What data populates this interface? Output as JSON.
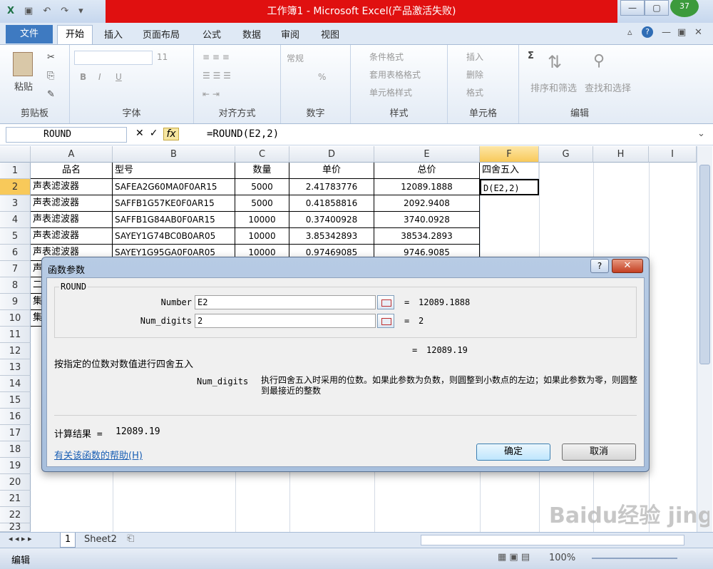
{
  "window": {
    "title": "工作簿1 - Microsoft Excel(产品激活失败)",
    "badge": "37"
  },
  "tabs": {
    "file": "文件",
    "home": "开始",
    "others": [
      "插入",
      "页面布局",
      "公式",
      "数据",
      "审阅",
      "视图"
    ]
  },
  "ribbon": {
    "clipboard": {
      "label": "剪贴板",
      "paste": "粘贴"
    },
    "font": {
      "label": "字体",
      "size": "11",
      "bold": "B",
      "italic": "I",
      "underline": "U"
    },
    "alignment": {
      "label": "对齐方式"
    },
    "number": {
      "label": "数字",
      "format": "常规",
      "percent": "%"
    },
    "styles": {
      "label": "样式",
      "items": [
        "条件格式",
        "套用表格格式",
        "单元格样式"
      ]
    },
    "cells": {
      "label": "单元格",
      "items": [
        "插入",
        "删除",
        "格式"
      ]
    },
    "editing": {
      "label": "编辑",
      "sort": "排序和筛选",
      "find": "查找和选择",
      "sum": "Σ"
    }
  },
  "formula_bar": {
    "name_box": "ROUND",
    "fx": "fx",
    "formula": "=ROUND(E2,2)"
  },
  "columns": [
    "A",
    "B",
    "C",
    "D",
    "E",
    "F",
    "G",
    "H",
    "I"
  ],
  "rows": [
    "1",
    "2",
    "3",
    "4",
    "5",
    "6",
    "7",
    "8",
    "9",
    "10",
    "11",
    "12",
    "13",
    "14",
    "15",
    "16",
    "17",
    "18",
    "19",
    "20",
    "21",
    "22",
    "23"
  ],
  "header_row": [
    "品名",
    "型号",
    "数量",
    "单价",
    "总价",
    "四舍五入"
  ],
  "data_rows": [
    [
      "声表滤波器",
      "SAFEA2G60MA0F0AR15",
      "5000",
      "2.41783776",
      "12089.1888",
      "D(E2,2)"
    ],
    [
      "声表滤波器",
      "SAFFB1G57KE0F0AR15",
      "5000",
      "0.41858816",
      "2092.9408",
      ""
    ],
    [
      "声表滤波器",
      "SAFFB1G84AB0F0AR15",
      "10000",
      "0.37400928",
      "3740.0928",
      ""
    ],
    [
      "声表滤波器",
      "SAYEY1G74BC0B0AR05",
      "10000",
      "3.85342893",
      "38534.2893",
      ""
    ],
    [
      "声表滤波器",
      "SAYEY1G95GA0F0AR05",
      "10000",
      "0.97469085",
      "9746.9085",
      ""
    ]
  ],
  "partial_rows": [
    "声",
    "二",
    "集",
    "集"
  ],
  "dialog": {
    "title": "函数参数",
    "function_name": "ROUND",
    "args": [
      {
        "name": "Number",
        "value": "E2",
        "result": "12089.1888"
      },
      {
        "name": "Num_digits",
        "value": "2",
        "result": "2"
      }
    ],
    "total_result": "12089.19",
    "description": "按指定的位数对数值进行四舍五入",
    "param_name": "Num_digits",
    "param_desc": "执行四舍五入时采用的位数。如果此参数为负数，则圆整到小数点的左边；如果此参数为零，则圆整到最接近的整数",
    "calc_label": "计算结果 =",
    "calc_value": "12089.19",
    "help_link": "有关该函数的帮助(H)",
    "ok": "确定",
    "cancel": "取消",
    "eq": "="
  },
  "sheets": {
    "tab1": "1",
    "tab2": "Sheet2"
  },
  "status": {
    "mode": "编辑",
    "zoom": "100%"
  },
  "watermark": "Baidu经验 jingyan.baidu.com"
}
